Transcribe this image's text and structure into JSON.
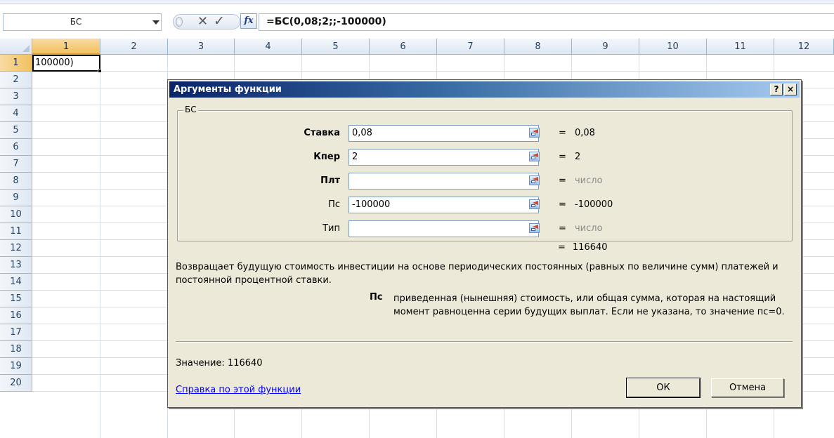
{
  "formula_bar": {
    "name_box": "БС",
    "fx_label": "fx",
    "formula": "=БС(0,08;2;;-100000)"
  },
  "sheet": {
    "columns": [
      "1",
      "2",
      "3",
      "4",
      "5",
      "6",
      "7",
      "8",
      "9",
      "10",
      "11",
      "12"
    ],
    "rows": [
      "1",
      "2",
      "3",
      "4",
      "5",
      "6",
      "7",
      "8",
      "9",
      "10",
      "11",
      "12",
      "13",
      "14",
      "15",
      "16",
      "17",
      "18",
      "19",
      "20"
    ],
    "active_cell_text": "100000)"
  },
  "dialog": {
    "title": "Аргументы функции",
    "help_button": "?",
    "close_button": "×",
    "group_legend": "БС",
    "args": [
      {
        "label": "Ставка",
        "value": "0,08",
        "equals": "=",
        "result": "0,08",
        "bold": true,
        "hint": false
      },
      {
        "label": "Кпер",
        "value": "2",
        "equals": "=",
        "result": "2",
        "bold": true,
        "hint": false
      },
      {
        "label": "Плт",
        "value": "",
        "equals": "=",
        "result": "число",
        "bold": true,
        "hint": true
      },
      {
        "label": "Пс",
        "value": "-100000",
        "equals": "=",
        "result": "-100000",
        "bold": false,
        "hint": false
      },
      {
        "label": "Тип",
        "value": "",
        "equals": "=",
        "result": "число",
        "bold": false,
        "hint": true
      }
    ],
    "total_equals": "=",
    "total_result": "116640",
    "description": "Возвращает будущую стоимость инвестиции на основе периодических постоянных (равных по величине сумм) платежей и постоянной процентной ставки.",
    "arg_help_name": "Пс",
    "arg_help_text": "приведенная (нынешняя) стоимость, или общая сумма, которая на настоящий момент равноценна серии будущих выплат. Если не указана, то значение пс=0.",
    "value_line": "Значение:  116640",
    "help_link": "Справка по этой функции",
    "ok_label": "ОК",
    "cancel_label": "Отмена"
  }
}
